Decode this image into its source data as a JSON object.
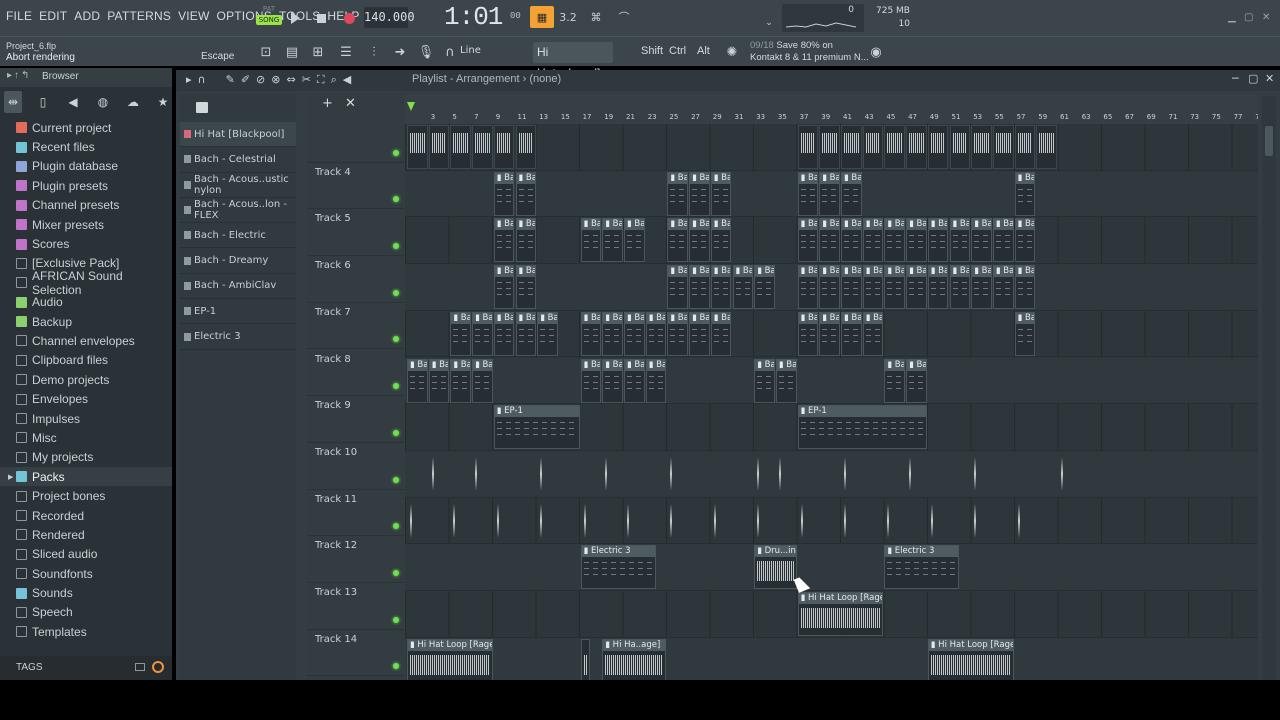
{
  "menu": [
    "FILE",
    "EDIT",
    "ADD",
    "PATTERNS",
    "VIEW",
    "OPTIONS",
    "TOOLS",
    "HELP"
  ],
  "transport": {
    "pat": "PAT",
    "song": "SONG",
    "tempo": "140.000",
    "time": "1:01",
    "time_sub": "00",
    "beat_icon_label": "3.2"
  },
  "monitor": {
    "cpu": "0",
    "memory": "725 MB",
    "voices": "10"
  },
  "project": {
    "name": "Project_6.flp",
    "hint": "Abort rendering",
    "escape_label": "Escape"
  },
  "toolbar2": {
    "snap": "Line",
    "hint_field": "Hi Hat..ckpool]",
    "keys": [
      "Shift",
      "Ctrl",
      "Alt"
    ]
  },
  "news": {
    "counter": "09/18",
    "line1": "Save 80% on",
    "line2": "Kontakt 8 & 11 premium N..."
  },
  "browser": {
    "title": "Browser",
    "items": [
      {
        "label": "Current project",
        "icon": "project-icon",
        "color": "#e46a5a"
      },
      {
        "label": "Recent files",
        "icon": "recent-icon",
        "color": "#73c3d9"
      },
      {
        "label": "Plugin database",
        "icon": "plugin-icon",
        "color": "#8fa4d9"
      },
      {
        "label": "Plugin presets",
        "icon": "plugin-icon",
        "color": "#c073c9"
      },
      {
        "label": "Channel presets",
        "icon": "channel-icon",
        "color": "#c073c9"
      },
      {
        "label": "Mixer presets",
        "icon": "mixer-icon",
        "color": "#c073c9"
      },
      {
        "label": "Scores",
        "icon": "note-icon",
        "color": "#c073c9"
      },
      {
        "label": "[Exclusive Pack]",
        "icon": "folder-icon",
        "color": ""
      },
      {
        "label": "AFRICAN Sound Selection",
        "icon": "folder-icon",
        "color": ""
      },
      {
        "label": "Audio",
        "icon": "person-icon",
        "color": "#8ccf6e"
      },
      {
        "label": "Backup",
        "icon": "backup-icon",
        "color": "#8ccf6e"
      },
      {
        "label": "Channel envelopes",
        "icon": "folder-icon",
        "color": ""
      },
      {
        "label": "Clipboard files",
        "icon": "folder-icon",
        "color": ""
      },
      {
        "label": "Demo projects",
        "icon": "folder-icon",
        "color": ""
      },
      {
        "label": "Envelopes",
        "icon": "folder-icon",
        "color": ""
      },
      {
        "label": "Impulses",
        "icon": "folder-icon",
        "color": ""
      },
      {
        "label": "Misc",
        "icon": "folder-icon",
        "color": ""
      },
      {
        "label": "My projects",
        "icon": "folder-icon",
        "color": ""
      },
      {
        "label": "Packs",
        "icon": "packs-icon",
        "color": "#73c3d9",
        "selected": true
      },
      {
        "label": "Project bones",
        "icon": "folder-icon",
        "color": ""
      },
      {
        "label": "Recorded",
        "icon": "folder-icon",
        "color": ""
      },
      {
        "label": "Rendered",
        "icon": "folder-icon",
        "color": ""
      },
      {
        "label": "Sliced audio",
        "icon": "folder-icon",
        "color": ""
      },
      {
        "label": "Soundfonts",
        "icon": "folder-icon",
        "color": ""
      },
      {
        "label": "Sounds",
        "icon": "cloud-icon",
        "color": "#73c3d9"
      },
      {
        "label": "Speech",
        "icon": "folder-icon",
        "color": ""
      },
      {
        "label": "Templates",
        "icon": "folder-icon",
        "color": ""
      }
    ],
    "tags_label": "TAGS"
  },
  "playlist": {
    "title": "Playlist - Arrangement",
    "pattern": "(none)",
    "patterns": [
      "Hi Hat [Blackpool]",
      "Bach - Celestrial",
      "Bach - Acous..ustic nylon",
      "Bach - Acous..lon - FLEX",
      "Bach - Electric",
      "Bach - Dreamy",
      "Bach - AmbiClav",
      "EP-1",
      "Electric 3"
    ],
    "tracks": [
      "",
      "Track 4",
      "Track 5",
      "Track 6",
      "Track 7",
      "Track 8",
      "Track 9",
      "Track 10",
      "Track 11",
      "Track 12",
      "Track 13",
      "Track 14"
    ],
    "bars": [
      "3",
      "5",
      "7",
      "9",
      "11",
      "13",
      "15",
      "17",
      "19",
      "21",
      "23",
      "25",
      "27",
      "29",
      "31",
      "33",
      "35",
      "37",
      "39",
      "41",
      "43",
      "45",
      "47",
      "49",
      "51",
      "53",
      "55",
      "57",
      "59",
      "61",
      "63",
      "65",
      "67",
      "69",
      "71",
      "73",
      "75",
      "77",
      "79"
    ],
    "clips": [
      {
        "track": 1,
        "bar": 9,
        "len": 2,
        "label": "Bac..lon"
      },
      {
        "track": 1,
        "bar": 11,
        "len": 2,
        "label": "Bac..lon"
      },
      {
        "track": 1,
        "bar": 25,
        "len": 2,
        "label": "Bac..lon"
      },
      {
        "track": 1,
        "bar": 27,
        "len": 2,
        "label": "Bac..lon"
      },
      {
        "track": 1,
        "bar": 29,
        "len": 2,
        "label": "Bac..lon"
      },
      {
        "track": 1,
        "bar": 37,
        "len": 2,
        "label": "Bac..lon"
      },
      {
        "track": 1,
        "bar": 39,
        "len": 2,
        "label": "Bac..lon"
      },
      {
        "track": 1,
        "bar": 41,
        "len": 2,
        "label": "Bac..lon"
      },
      {
        "track": 1,
        "bar": 57,
        "len": 2,
        "label": "Bac..lon"
      },
      {
        "track": 2,
        "bar": 9,
        "len": 2,
        "label": "Bac..tric"
      },
      {
        "track": 2,
        "bar": 11,
        "len": 2,
        "label": "Bac..tric"
      },
      {
        "track": 2,
        "bar": 17,
        "len": 2,
        "label": "Bac..tric"
      },
      {
        "track": 2,
        "bar": 19,
        "len": 2,
        "label": "Bac..tric"
      },
      {
        "track": 2,
        "bar": 21,
        "len": 2,
        "label": "Bac..tric"
      },
      {
        "track": 2,
        "bar": 25,
        "len": 2,
        "label": "Bac..tric"
      },
      {
        "track": 2,
        "bar": 27,
        "len": 2,
        "label": "Bac..tric"
      },
      {
        "track": 2,
        "bar": 29,
        "len": 2,
        "label": "Bac..tric"
      },
      {
        "track": 2,
        "bar": 37,
        "len": 2,
        "label": "Bac..tric"
      },
      {
        "track": 2,
        "bar": 39,
        "len": 2,
        "label": "Bac..tric"
      },
      {
        "track": 2,
        "bar": 41,
        "len": 2,
        "label": "Bac..tric"
      },
      {
        "track": 2,
        "bar": 43,
        "len": 2,
        "label": "Bac..tric"
      },
      {
        "track": 2,
        "bar": 45,
        "len": 2,
        "label": "Bac..tric"
      },
      {
        "track": 2,
        "bar": 47,
        "len": 2,
        "label": "Bac..tric"
      },
      {
        "track": 2,
        "bar": 49,
        "len": 2,
        "label": "Bac..tric"
      },
      {
        "track": 2,
        "bar": 51,
        "len": 2,
        "label": "Bac..tric"
      },
      {
        "track": 2,
        "bar": 53,
        "len": 2,
        "label": "Bac..tric"
      },
      {
        "track": 2,
        "bar": 55,
        "len": 2,
        "label": "Bac..tric"
      },
      {
        "track": 2,
        "bar": 57,
        "len": 2,
        "label": "Bac..tric"
      },
      {
        "track": 3,
        "bar": 9,
        "len": 2,
        "label": "Ba..amy"
      },
      {
        "track": 3,
        "bar": 11,
        "len": 2,
        "label": "Ba..amy"
      },
      {
        "track": 3,
        "bar": 25,
        "len": 2,
        "label": "Ba..amy"
      },
      {
        "track": 3,
        "bar": 27,
        "len": 2,
        "label": "Ba..amy"
      },
      {
        "track": 3,
        "bar": 29,
        "len": 2,
        "label": "Ba..amy"
      },
      {
        "track": 3,
        "bar": 31,
        "len": 2,
        "label": "Ba..amy"
      },
      {
        "track": 3,
        "bar": 33,
        "len": 2,
        "label": "Ba..amy"
      },
      {
        "track": 3,
        "bar": 37,
        "len": 2,
        "label": "Ba..amy"
      },
      {
        "track": 3,
        "bar": 39,
        "len": 2,
        "label": "Ba..amy"
      },
      {
        "track": 3,
        "bar": 41,
        "len": 2,
        "label": "Ba..amy"
      },
      {
        "track": 3,
        "bar": 43,
        "len": 2,
        "label": "Ba..amy"
      },
      {
        "track": 3,
        "bar": 45,
        "len": 2,
        "label": "Ba..amy"
      },
      {
        "track": 3,
        "bar": 47,
        "len": 2,
        "label": "Ba..amy"
      },
      {
        "track": 3,
        "bar": 49,
        "len": 2,
        "label": "Ba..amy"
      },
      {
        "track": 3,
        "bar": 51,
        "len": 2,
        "label": "Ba..amy"
      },
      {
        "track": 3,
        "bar": 53,
        "len": 2,
        "label": "Ba..amy"
      },
      {
        "track": 3,
        "bar": 55,
        "len": 2,
        "label": "Ba..amy"
      },
      {
        "track": 3,
        "bar": 57,
        "len": 2,
        "label": "Ba..amy"
      },
      {
        "track": 4,
        "bar": 5,
        "len": 2,
        "label": "Ba..Clav"
      },
      {
        "track": 4,
        "bar": 7,
        "len": 2,
        "label": "Ba..Clav"
      },
      {
        "track": 4,
        "bar": 9,
        "len": 2,
        "label": "Ba..Clav"
      },
      {
        "track": 4,
        "bar": 11,
        "len": 2,
        "label": "Ba..Clav"
      },
      {
        "track": 4,
        "bar": 13,
        "len": 2,
        "label": "Ba..Clav"
      },
      {
        "track": 4,
        "bar": 17,
        "len": 2,
        "label": "Ba..Clav"
      },
      {
        "track": 4,
        "bar": 19,
        "len": 2,
        "label": "Ba..Clav"
      },
      {
        "track": 4,
        "bar": 21,
        "len": 2,
        "label": "Ba..Clav"
      },
      {
        "track": 4,
        "bar": 23,
        "len": 2,
        "label": "Ba..Clav"
      },
      {
        "track": 4,
        "bar": 25,
        "len": 2,
        "label": "Ba..Clav"
      },
      {
        "track": 4,
        "bar": 27,
        "len": 2,
        "label": "Ba..Clav"
      },
      {
        "track": 4,
        "bar": 29,
        "len": 2,
        "label": "Ba..Clav"
      },
      {
        "track": 4,
        "bar": 37,
        "len": 2,
        "label": "Ba..Clav"
      },
      {
        "track": 4,
        "bar": 39,
        "len": 2,
        "label": "Ba..Clav"
      },
      {
        "track": 4,
        "bar": 41,
        "len": 2,
        "label": "Ba..Clav"
      },
      {
        "track": 4,
        "bar": 43,
        "len": 2,
        "label": "Ba..Clav"
      },
      {
        "track": 4,
        "bar": 57,
        "len": 2,
        "label": "Ba..Clav"
      },
      {
        "track": 5,
        "bar": 1,
        "len": 2,
        "label": "Bac..EX"
      },
      {
        "track": 5,
        "bar": 3,
        "len": 2,
        "label": "Bac..EX"
      },
      {
        "track": 5,
        "bar": 5,
        "len": 2,
        "label": "Bac..EX"
      },
      {
        "track": 5,
        "bar": 7,
        "len": 2,
        "label": "Bac..EX"
      },
      {
        "track": 5,
        "bar": 17,
        "len": 2,
        "label": "Bac..EX"
      },
      {
        "track": 5,
        "bar": 19,
        "len": 2,
        "label": "Bac..EX"
      },
      {
        "track": 5,
        "bar": 21,
        "len": 2,
        "label": "Bac..EX"
      },
      {
        "track": 5,
        "bar": 23,
        "len": 2,
        "label": "Bac..EX"
      },
      {
        "track": 5,
        "bar": 33,
        "len": 2,
        "label": "Bac..EX"
      },
      {
        "track": 5,
        "bar": 35,
        "len": 2,
        "label": "Bac..EX"
      },
      {
        "track": 5,
        "bar": 45,
        "len": 2,
        "label": "Bac..EX"
      },
      {
        "track": 5,
        "bar": 47,
        "len": 2,
        "label": "Bac..EX"
      },
      {
        "track": 6,
        "bar": 9,
        "len": 8,
        "label": "EP-1"
      },
      {
        "track": 6,
        "bar": 37,
        "len": 12,
        "label": "EP-1"
      },
      {
        "track": 9,
        "bar": 17,
        "len": 7,
        "label": "Electric 3"
      },
      {
        "track": 9,
        "bar": 33,
        "len": 4,
        "label": "Dru...in'}",
        "audio": true
      },
      {
        "track": 9,
        "bar": 45,
        "len": 7,
        "label": "Electric 3"
      },
      {
        "track": 10,
        "bar": 37,
        "len": 8,
        "label": "Hi Hat Loop [Rage]",
        "audio": true
      },
      {
        "track": 11,
        "bar": 1,
        "len": 8,
        "label": "Hi Hat Loop [Rage]",
        "audio": true
      },
      {
        "track": 11,
        "bar": 17,
        "len": 1,
        "label": "",
        "audio": true
      },
      {
        "track": 11,
        "bar": 19,
        "len": 6,
        "label": "Hi Ha..age]",
        "audio": true
      },
      {
        "track": 11,
        "bar": 49,
        "len": 8,
        "label": "Hi Hat Loop [Rage]",
        "audio": true
      }
    ],
    "spikes": [
      {
        "track": 7,
        "bars": [
          3,
          7,
          13,
          19,
          25,
          33,
          35,
          41,
          47,
          53,
          61
        ]
      },
      {
        "track": 8,
        "bars": [
          1,
          5,
          9,
          13,
          17,
          21,
          25,
          29,
          33,
          37,
          41,
          45,
          49,
          53,
          57
        ]
      }
    ],
    "hihat_bars": [
      1,
      3,
      5,
      7,
      9,
      11,
      37,
      39,
      41,
      43,
      45,
      47,
      49,
      51,
      53,
      55,
      57,
      59
    ]
  }
}
